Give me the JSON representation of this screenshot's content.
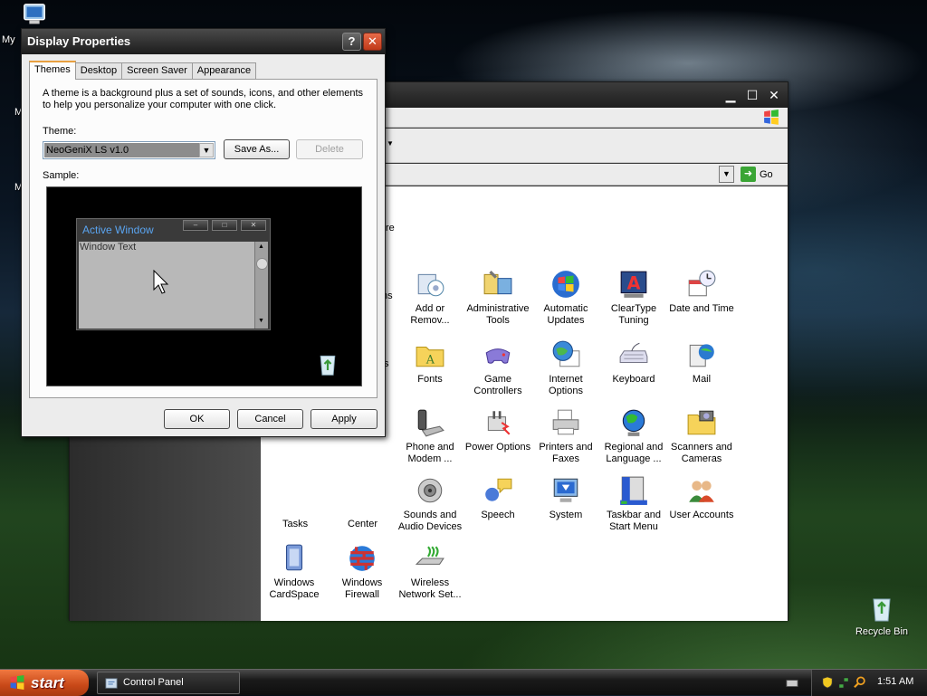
{
  "desktop": {
    "icons": [
      {
        "label": "My"
      },
      {
        "label": "M"
      },
      {
        "label": "M"
      },
      {
        "label": "Recycle Bin"
      }
    ]
  },
  "control_panel": {
    "go_label": "Go",
    "items": [
      {
        "label": "Add or Remov..."
      },
      {
        "label": "Administrative Tools"
      },
      {
        "label": "Automatic Updates"
      },
      {
        "label": "ClearType Tuning"
      },
      {
        "label": "Date and Time"
      },
      {
        "label": "Fonts"
      },
      {
        "label": "Game Controllers"
      },
      {
        "label": "Internet Options"
      },
      {
        "label": "Keyboard"
      },
      {
        "label": "Mail"
      },
      {
        "label": "Phone and Modem ..."
      },
      {
        "label": "Power Options"
      },
      {
        "label": "Printers and Faxes"
      },
      {
        "label": "Regional and Language ..."
      },
      {
        "label": "Scanners and Cameras"
      },
      {
        "label": "Sounds and Audio Devices"
      },
      {
        "label": "Speech"
      },
      {
        "label": "System"
      },
      {
        "label": "Taskbar and Start Menu"
      },
      {
        "label": "User Accounts"
      },
      {
        "label": "Windows CardSpace"
      },
      {
        "label": "Windows Firewall"
      },
      {
        "label": "Wireless Network Set..."
      }
    ],
    "partial_labels": [
      "re",
      "ns",
      "s",
      "Tasks",
      "Center"
    ]
  },
  "display_properties": {
    "title": "Display Properties",
    "tabs": [
      {
        "label": "Themes",
        "active": true
      },
      {
        "label": "Desktop",
        "active": false
      },
      {
        "label": "Screen Saver",
        "active": false
      },
      {
        "label": "Appearance",
        "active": false
      }
    ],
    "description": "A theme is a background plus a set of sounds, icons, and other elements to help you personalize your computer with one click.",
    "theme_label": "Theme:",
    "theme_value": "NeoGeniX LS v1.0",
    "save_as_label": "Save As...",
    "delete_label": "Delete",
    "sample_label": "Sample:",
    "sample": {
      "active_window_title": "Active Window",
      "window_text": "Window Text"
    },
    "ok_label": "OK",
    "cancel_label": "Cancel",
    "apply_label": "Apply"
  },
  "taskbar": {
    "start_label": "start",
    "task_items": [
      {
        "label": "Control Panel"
      }
    ],
    "clock": "1:51 AM"
  },
  "colors": {
    "start_button": "#d85a20",
    "dialog_bg": "#ececec",
    "active_tab_accent": "#e8a040",
    "sample_title": "#5aa4f0"
  }
}
